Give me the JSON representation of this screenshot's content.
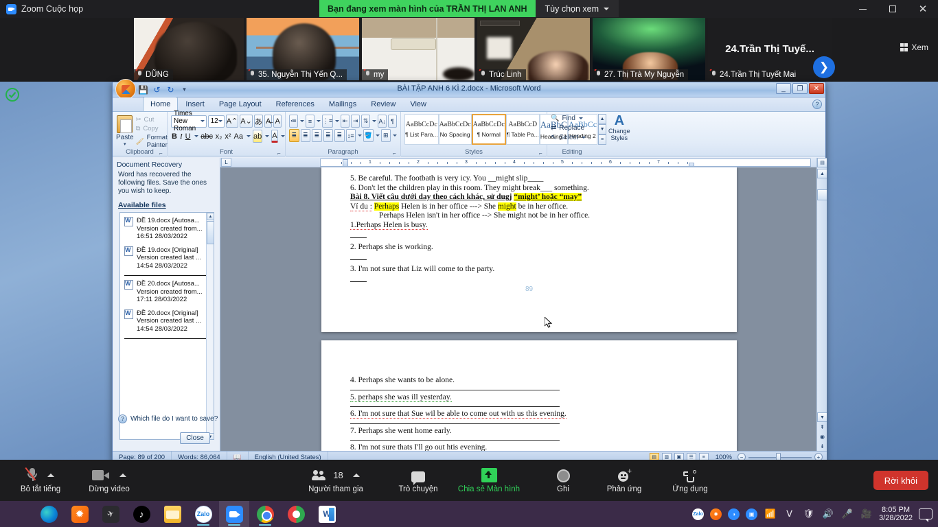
{
  "zoom_window": {
    "app_title": "Zoom Cuộc họp",
    "share_banner": "Bạn đang xem màn hình của TRẦN THỊ LAN ANH",
    "view_options": "Tùy chọn xem",
    "view_label": "Xem",
    "window_controls": {
      "minimize": "minimize",
      "maximize": "maximize",
      "close": "close"
    },
    "participants": [
      {
        "name": "DŨNG",
        "muted": true
      },
      {
        "name": "35. Nguyễn Thị Yến Q...",
        "muted": true
      },
      {
        "name": "my",
        "muted": true
      },
      {
        "name": "Trúc Linh",
        "muted": true
      },
      {
        "name": "27. Thị Trà My Nguyễn",
        "muted": true
      },
      {
        "name": "24.Trần Thị Tuyết Mai",
        "muted": true
      }
    ],
    "spotlight_name": "24.Trần Thị Tuyế..."
  },
  "zoom_toolbar": {
    "mute": "Bỏ tắt tiếng",
    "video": "Dừng video",
    "participants": "Người tham gia",
    "participants_count": "18",
    "chat": "Trò chuyện",
    "share": "Chia sẻ Màn hình",
    "record": "Ghi",
    "reactions": "Phản ứng",
    "apps": "Ứng dụng",
    "leave": "Rời khỏi"
  },
  "word": {
    "title": "BÀI TẬP ANH 6 KÌ 2.docx  -  Microsoft Word",
    "quick_access": [
      "save-icon",
      "undo-icon",
      "redo-icon",
      "customize-icon"
    ],
    "tabs": [
      {
        "label": "Home",
        "active": true
      },
      {
        "label": "Insert",
        "active": false
      },
      {
        "label": "Page Layout",
        "active": false
      },
      {
        "label": "References",
        "active": false
      },
      {
        "label": "Mailings",
        "active": false
      },
      {
        "label": "Review",
        "active": false
      },
      {
        "label": "View",
        "active": false
      }
    ],
    "ribbon": {
      "clipboard": {
        "group_label": "Clipboard",
        "paste": "Paste",
        "cut": "Cut",
        "copy": "Copy",
        "format_painter": "Format Painter"
      },
      "font": {
        "group_label": "Font",
        "font_name": "Times New Roman",
        "font_size": "12",
        "buttons": [
          "grow-font-icon",
          "shrink-font-icon",
          "change-case-icon",
          "clear-formatting-icon",
          "phonetic-guide-icon",
          "character-border-icon",
          "bold-icon",
          "italic-icon",
          "underline-icon",
          "strikethrough-icon",
          "subscript-icon",
          "superscript-icon",
          "text-highlight-icon",
          "font-color-icon"
        ]
      },
      "paragraph": {
        "group_label": "Paragraph",
        "buttons": [
          "bullets-icon",
          "numbering-icon",
          "multilevel-list-icon",
          "decrease-indent-icon",
          "increase-indent-icon",
          "sort-icon",
          "show-marks-icon",
          "align-left-icon",
          "align-center-icon",
          "align-right-icon",
          "justify-icon",
          "line-spacing-icon",
          "shading-icon",
          "borders-icon"
        ]
      },
      "styles": {
        "group_label": "Styles",
        "items": [
          {
            "sample": "AaBbCcDc",
            "name": "¶ List Para...",
            "selected": false
          },
          {
            "sample": "AaBbCcDc",
            "name": "No Spacing",
            "selected": false
          },
          {
            "sample": "AaBbCcDc",
            "name": "¶ Normal",
            "selected": true
          },
          {
            "sample": "AaBbCcD",
            "name": "¶ Table Pa...",
            "selected": false
          },
          {
            "sample": "AaBbC",
            "name": "Heading 1",
            "selected": false
          },
          {
            "sample": "AaBbCc",
            "name": "Heading 2",
            "selected": false
          }
        ],
        "change_styles": "Change Styles"
      },
      "editing": {
        "group_label": "Editing",
        "find": "Find",
        "replace": "Replace",
        "select": "Select"
      }
    },
    "recovery_pane": {
      "title": "Document Recovery",
      "description": "Word has recovered the following files. Save the ones you wish to keep.",
      "available_files_label": "Available files",
      "files": [
        {
          "name": "ĐỀ 19.docx  [Autosa...",
          "version": "Version created from...",
          "time": "16:51 28/03/2022",
          "separator_after": false
        },
        {
          "name": "ĐỀ 19.docx  [Original]",
          "version": "Version created last ...",
          "time": "14:54 28/03/2022",
          "separator_after": true
        },
        {
          "name": "ĐỀ 20.docx  [Autosa...",
          "version": "Version created from...",
          "time": "17:11 28/03/2022",
          "separator_after": false
        },
        {
          "name": "ĐỀ 20.docx  [Original]",
          "version": "Version created last ...",
          "time": "14:54 28/03/2022",
          "separator_after": true
        }
      ],
      "help_link": "Which file do I want to save?",
      "close_button": "Close"
    },
    "document": {
      "page1_lines": [
        "5. Be careful. The footbath is very icy. You __might slip____",
        "6. Don't let the children play in this room. They might break___ something."
      ],
      "exercise_heading": "Bài 8. Viết câu dưới day theo cách khác, sử dugj",
      "exercise_heading_hl1": "“might’ hoặc “may”",
      "example_label": "Ví du :",
      "example_hl": "Perhaps",
      "example_rest_a": "Helen is in her office --->  She",
      "example_hl2": "might",
      "example_rest_b": "be in her office.",
      "example_line2": "Perhaps Helen isn't in her office --> She might not be in her office.",
      "items": [
        "1.Perhaps Helen is busy.",
        "2. Perhaps she is working.",
        "3. I'm not sure that Liz will come to the party."
      ],
      "page_number_watermark": "89",
      "page2_items": [
        "4. Perhaps she wants to be alone.",
        "5. perhaps she was ill yesterday.",
        "6. I'm not sure that Sue wil be able to come out with us this evening.",
        "7. Perhaps she went home early.",
        "8. I'm not sure thats I'll go out htis evening."
      ]
    },
    "status_bar": {
      "page": "Page: 89 of 200",
      "words": "Words: 86,064",
      "language": "English (United States)",
      "zoom": "100%",
      "views": [
        "print-layout-icon",
        "full-screen-reading-icon",
        "web-layout-icon",
        "outline-icon",
        "draft-icon"
      ]
    },
    "ruler_numbers": [
      "1",
      "2",
      "3",
      "4",
      "5",
      "6",
      "7"
    ]
  },
  "taskbar": {
    "apps": [
      {
        "name": "start-icon",
        "active": false,
        "running": false
      },
      {
        "name": "edge-icon",
        "active": false,
        "running": false
      },
      {
        "name": "sun-app-icon",
        "active": false,
        "running": false
      },
      {
        "name": "dark-app-icon",
        "active": false,
        "running": false
      },
      {
        "name": "tiktok-icon",
        "active": false,
        "running": false
      },
      {
        "name": "file-explorer-icon",
        "active": false,
        "running": false
      },
      {
        "name": "zalo-icon",
        "active": false,
        "running": true
      },
      {
        "name": "zoom-icon",
        "active": true,
        "running": true
      },
      {
        "name": "chrome-icon",
        "active": false,
        "running": true
      },
      {
        "name": "unikey-icon",
        "active": false,
        "running": false
      },
      {
        "name": "word-icon",
        "active": false,
        "running": false
      }
    ],
    "tray": [
      "zalo-tray-icon",
      "sun-tray-icon",
      "blue-tray-icon",
      "zoom-tray-icon",
      "wifi-icon",
      "v-icon",
      "security-warning-icon",
      "volume-icon",
      "mic-icon",
      "camera-icon"
    ],
    "clock_time": "8:05 PM",
    "clock_date": "3/28/2022",
    "notification": "notification-icon"
  },
  "colors": {
    "zoom_green": "#3fd35e",
    "zoom_blue": "#2d8cff",
    "leave_red": "#d0342c",
    "taskbar": "#3b2b48",
    "highlight_yellow": "#ffff00",
    "style_selected": "#e8a33d"
  }
}
